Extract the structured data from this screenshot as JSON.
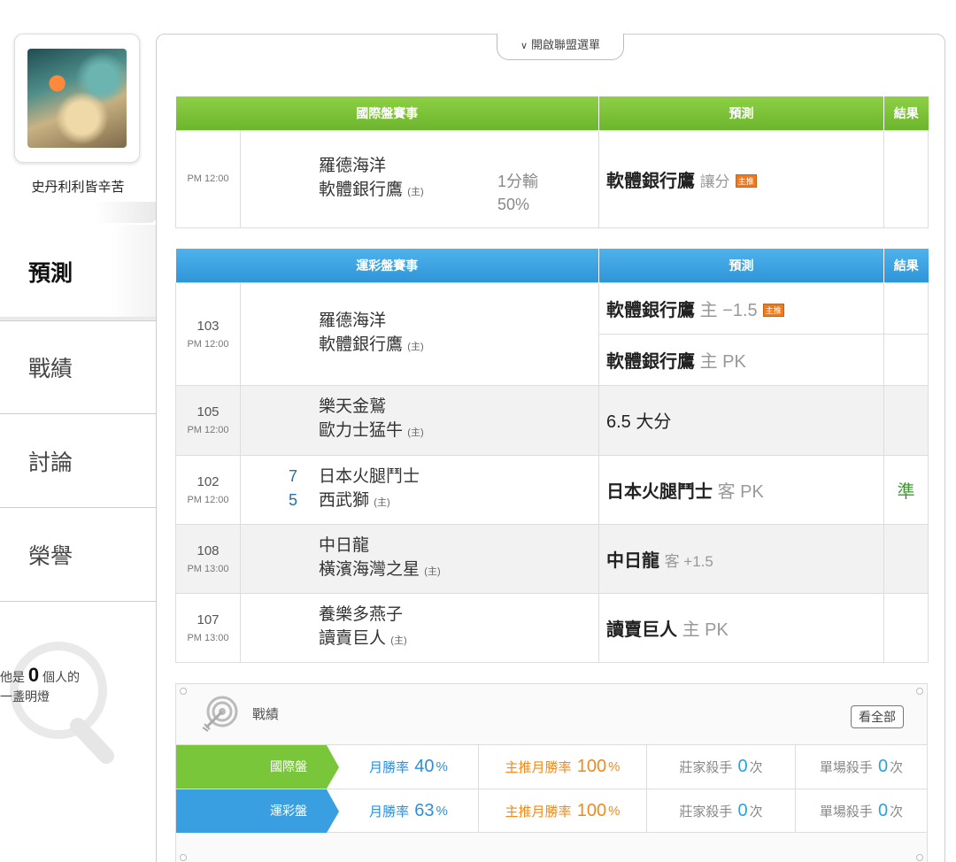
{
  "user": {
    "name": "史丹利利皆辛苦"
  },
  "nav": [
    {
      "label": "預測",
      "active": true
    },
    {
      "label": "戰績"
    },
    {
      "label": "討論"
    },
    {
      "label": "榮譽"
    }
  ],
  "lamp": {
    "prefix": "他是",
    "count": "0",
    "suffix": "個人的",
    "line2": "一盞明燈"
  },
  "league_toggle": "開啟聯盟選單",
  "intl": {
    "header": {
      "match": "國際盤賽事",
      "predict": "預測",
      "result": "結果"
    },
    "rows": [
      {
        "time": "PM 12:00",
        "away": "羅德海洋",
        "home": "軟體銀行鷹",
        "home_mark": "(主)",
        "odds1": "1分輸",
        "odds2": "50%",
        "pick": "軟體銀行鷹",
        "pick_sub": "讓分",
        "tag": "主推",
        "result": ""
      }
    ]
  },
  "sports": {
    "header": {
      "match": "運彩盤賽事",
      "predict": "預測",
      "result": "結果"
    },
    "rows": [
      {
        "no": "103",
        "time": "PM 12:00",
        "away": "羅德海洋",
        "home": "軟體銀行鷹",
        "home_mark": "(主)",
        "pick1": "軟體銀行鷹",
        "pick1_sub": "主 −1.5",
        "tag": "主推",
        "pick2": "軟體銀行鷹",
        "pick2_sub": "主 PK"
      },
      {
        "no": "105",
        "time": "PM 12:00",
        "away": "樂天金鷲",
        "home": "歐力士猛牛",
        "home_mark": "(主)",
        "pick": "6.5 大分",
        "pick_sub": "",
        "result": ""
      },
      {
        "no": "102",
        "time": "PM 12:00",
        "score_away": "7",
        "score_home": "5",
        "away": "日本火腿鬥士",
        "home": "西武獅",
        "home_mark": "(主)",
        "pick": "日本火腿鬥士",
        "pick_sub": "客 PK",
        "result": "準"
      },
      {
        "no": "108",
        "time": "PM 13:00",
        "away": "中日龍",
        "home": "橫濱海灣之星",
        "home_mark": "(主)",
        "pick": "中日龍",
        "pick_sub": "客 +1.5",
        "result": ""
      },
      {
        "no": "107",
        "time": "PM 13:00",
        "away": "養樂多燕子",
        "home": "讀賣巨人",
        "home_mark": "(主)",
        "pick": "讀賣巨人",
        "pick_sub": "主 PK",
        "result": ""
      }
    ]
  },
  "stats": {
    "title": "戰績",
    "view_all": "看全部",
    "rows": [
      {
        "label": "國際盤",
        "month_label": "月勝率",
        "month_val": "40",
        "month_unit": "%",
        "main_label": "主推月勝率",
        "main_val": "100",
        "main_unit": "%",
        "banker_label": "莊家殺手",
        "banker_val": "0",
        "banker_unit": "次",
        "single_label": "單場殺手",
        "single_val": "0",
        "single_unit": "次"
      },
      {
        "label": "運彩盤",
        "month_label": "月勝率",
        "month_val": "63",
        "month_unit": "%",
        "main_label": "主推月勝率",
        "main_val": "100",
        "main_unit": "%",
        "banker_label": "莊家殺手",
        "banker_val": "0",
        "banker_unit": "次",
        "single_label": "單場殺手",
        "single_val": "0",
        "single_unit": "次"
      }
    ]
  }
}
